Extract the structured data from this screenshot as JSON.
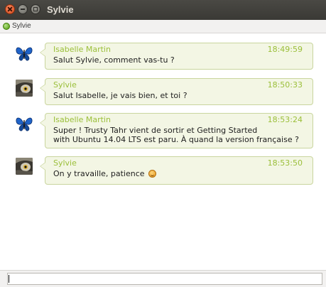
{
  "window": {
    "title": "Sylvie"
  },
  "status": {
    "contact": "Sylvie",
    "presence_color": "#4e9a06"
  },
  "messages": [
    {
      "sender": "Isabelle Martin",
      "time": "18:49:59",
      "avatar": "butterfly-icon",
      "lines": [
        "Salut Sylvie, comment vas-tu ?"
      ]
    },
    {
      "sender": "Sylvie",
      "time": "18:50:33",
      "avatar": "owl-icon",
      "lines": [
        "Salut Isabelle, je vais bien, et toi ?"
      ]
    },
    {
      "sender": "Isabelle Martin",
      "time": "18:53:24",
      "avatar": "butterfly-icon",
      "lines": [
        "Super ! Trusty Tahr vient de sortir et Getting Started",
        "with Ubuntu 14.04 LTS est paru. À quand la version française ?"
      ]
    },
    {
      "sender": "Sylvie",
      "time": "18:53:50",
      "avatar": "owl-icon",
      "lines": [
        "On y travaille, patience"
      ],
      "emoji": "smiley-icon"
    }
  ],
  "input": {
    "value": ""
  },
  "colors": {
    "accent": "#9bbf3a",
    "bubble_bg": "#f3f6e4",
    "bubble_border": "#c9d59e"
  }
}
